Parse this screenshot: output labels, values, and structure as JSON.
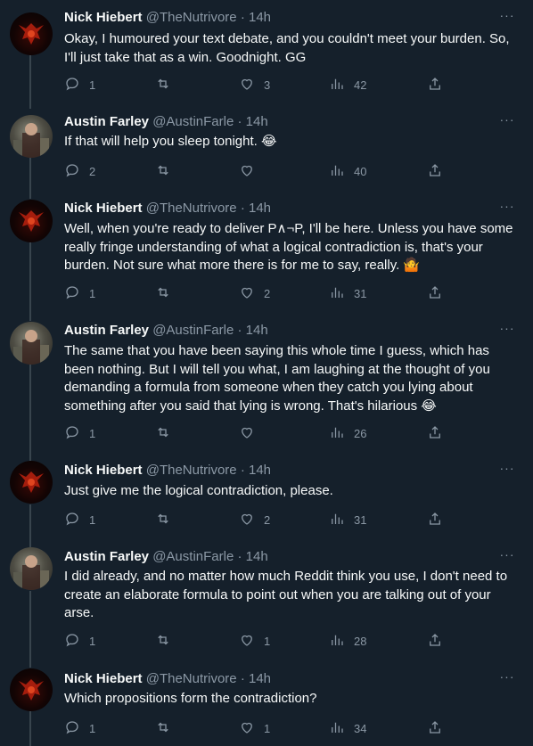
{
  "tweets": [
    {
      "author": "Nick Hiebert",
      "handle": "@TheNutrivore",
      "dot": "·",
      "time": "14h",
      "avatar": "nick",
      "text": "Okay, I humoured your text debate, and you couldn't meet your burden. So, I'll just take that as a win. Goodnight. GG",
      "replies": "1",
      "retweets": "",
      "likes": "3",
      "views": "42"
    },
    {
      "author": "Austin Farley",
      "handle": "@AustinFarle",
      "dot": "·",
      "time": "14h",
      "avatar": "austin",
      "text": "If that will help you sleep tonight. 😂",
      "replies": "2",
      "retweets": "",
      "likes": "",
      "views": "40"
    },
    {
      "author": "Nick Hiebert",
      "handle": "@TheNutrivore",
      "dot": "·",
      "time": "14h",
      "avatar": "nick",
      "text": "Well, when you're ready to deliver P∧¬P, I'll be here. Unless you have some really fringe understanding of what a logical contradiction is, that's your burden. Not sure what more there is for me to say, really. 🤷",
      "replies": "1",
      "retweets": "",
      "likes": "2",
      "views": "31"
    },
    {
      "author": "Austin Farley",
      "handle": "@AustinFarle",
      "dot": "·",
      "time": "14h",
      "avatar": "austin",
      "text": "The same that you have been saying this whole time I guess, which has been nothing. But I will tell you what, I am laughing at the thought of you demanding a formula from someone when they catch you lying about something after you said that lying is wrong. That's hilarious 😂",
      "replies": "1",
      "retweets": "",
      "likes": "",
      "views": "26"
    },
    {
      "author": "Nick Hiebert",
      "handle": "@TheNutrivore",
      "dot": "·",
      "time": "14h",
      "avatar": "nick",
      "text": "Just give me the logical contradiction, please.",
      "replies": "1",
      "retweets": "",
      "likes": "2",
      "views": "31"
    },
    {
      "author": "Austin Farley",
      "handle": "@AustinFarle",
      "dot": "·",
      "time": "14h",
      "avatar": "austin",
      "text": "I did already, and no matter how much Reddit think you use, I don't need to create an elaborate formula to point out when you are talking out of your arse.",
      "replies": "1",
      "retweets": "",
      "likes": "1",
      "views": "28"
    },
    {
      "author": "Nick Hiebert",
      "handle": "@TheNutrivore",
      "dot": "·",
      "time": "14h",
      "avatar": "nick",
      "text": "Which propositions form the contradiction?",
      "replies": "1",
      "retweets": "",
      "likes": "1",
      "views": "34"
    }
  ],
  "icons": {
    "reply": "reply-icon",
    "retweet": "retweet-icon",
    "like": "heart-icon",
    "views": "views-icon",
    "share": "share-icon",
    "more": "more-icon"
  },
  "colors": {
    "background": "#15202b",
    "text": "#f7f9f9",
    "muted": "#8b98a5",
    "divider": "#38444d"
  }
}
